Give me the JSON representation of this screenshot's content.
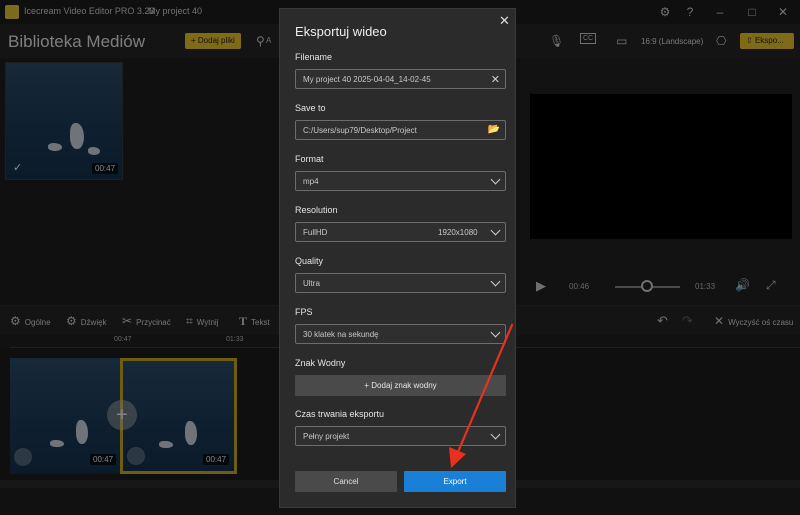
{
  "window": {
    "app_title": "Icecream Video Editor PRO 3.23",
    "project_title": "My project 40",
    "icons": [
      "settings-icon",
      "help-icon",
      "minimize-icon",
      "maximize-icon",
      "close-icon"
    ]
  },
  "toolbar": {
    "library_title": "Biblioteka Mediów",
    "add_files_label": "Dodaj pliki",
    "a_label": "A",
    "aspect_label": "16:9 (Landscape)",
    "export_label": "Ekspo..."
  },
  "media": {
    "items": [
      {
        "duration": "00:47",
        "checked": true
      }
    ]
  },
  "player": {
    "current_time": "00:46",
    "total_time": "01:33"
  },
  "edit_tools": {
    "items": [
      {
        "label": "Ogólne",
        "icon": "gear-icon"
      },
      {
        "label": "Dźwięk",
        "icon": "audio-gear-icon"
      },
      {
        "label": "Przycinać",
        "icon": "scissors-icon"
      },
      {
        "label": "Wytnij",
        "icon": "crop-icon"
      },
      {
        "label": "Tekst",
        "icon": "text-icon"
      }
    ],
    "clear_timeline": "Wyczyść oś czasu"
  },
  "timeline": {
    "ticks": [
      "00:47",
      "01:33"
    ],
    "clips": [
      {
        "duration": "00:47"
      },
      {
        "duration": "00:47"
      }
    ]
  },
  "dialog": {
    "title": "Eksportuj wideo",
    "filename": {
      "label": "Filename",
      "value": "My project 40 2025-04-04_14-02-45"
    },
    "save_to": {
      "label": "Save to",
      "value": "C:/Users/sup79/Desktop/Project"
    },
    "format": {
      "label": "Format",
      "value": "mp4"
    },
    "resolution": {
      "label": "Resolution",
      "value": "FullHD",
      "detail": "1920x1080"
    },
    "quality": {
      "label": "Quality",
      "value": "Ultra"
    },
    "fps": {
      "label": "FPS",
      "value": "30 klatek na sekundę"
    },
    "watermark": {
      "label": "Znak Wodny",
      "button": "Dodaj znak wodny"
    },
    "duration": {
      "label": "Czas trwania eksportu",
      "value": "Pełny projekt"
    },
    "cancel_label": "Cancel",
    "export_label": "Export"
  },
  "colors": {
    "accent_yellow": "#e8c32b",
    "export_blue": "#1a7fd6",
    "annotation_red": "#e8321e"
  }
}
